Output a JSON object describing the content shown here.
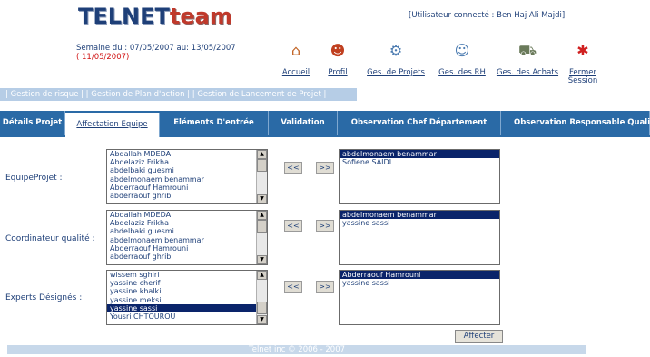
{
  "header": {
    "logo_part1": "TELNET",
    "logo_part2": "team",
    "user_status": "[Utilisateur connecté : Ben Haj Ali Majdi]",
    "week_line": "Semaine du : 07/05/2007 au: 13/05/2007",
    "week_date": "( 11/05/2007)"
  },
  "nav": [
    {
      "label": "Accueil",
      "icon": "house-icon",
      "glyph": "🏠"
    },
    {
      "label": "Profil",
      "icon": "user-profile-icon",
      "glyph": "👤"
    },
    {
      "label": "Ges. de Projets",
      "icon": "gears-icon",
      "glyph": "⚙"
    },
    {
      "label": "Ges. des RH",
      "icon": "person-icon",
      "glyph": "👤"
    },
    {
      "label": "Ges. des Achats",
      "icon": "cart-icon",
      "glyph": "🛒"
    },
    {
      "label": "Fermer Session",
      "icon": "logout-icon",
      "glyph": "🚶"
    }
  ],
  "linkbar": "| Gestion de risque |   | Gestion de Plan d'action |   | Gestion de Lancement de Projet |",
  "tabs": [
    {
      "label": "Détails Projet"
    },
    {
      "label": "Affectation Equipe"
    },
    {
      "label": "Eléments D'entrée"
    },
    {
      "label": "Validation"
    },
    {
      "label": "Observation Chef Département"
    },
    {
      "label": "Observation Responsable Quali"
    }
  ],
  "rows": [
    {
      "label": "EquipeProjet :",
      "available": [
        "Abdallah MDEDA",
        "Abdelaziz Frikha",
        "abdelbaki guesmi",
        "abdelmonaem benammar",
        "Abderraouf Hamrouni",
        "abderraouf ghribi"
      ],
      "selected": [
        "abdelmonaem benammar",
        "Sofiene SAIDI"
      ]
    },
    {
      "label": "Coordinateur qualité :",
      "available": [
        "Abdallah MDEDA",
        "Abdelaziz Frikha",
        "abdelbaki guesmi",
        "abdelmonaem benammar",
        "Abderraouf Hamrouni",
        "abderraouf ghribi"
      ],
      "selected": [
        "abdelmonaem benammar",
        "yassine sassi"
      ]
    },
    {
      "label": "Experts Désignés :",
      "available": [
        "wissem sghiri",
        "yassine cherif",
        "yassine khalki",
        "yassine meksi",
        "yassine sassi",
        "Yousri CHTOUROU"
      ],
      "selected": [
        "Abderraouf Hamrouni",
        "yassine sassi"
      ]
    }
  ],
  "buttons": {
    "remove": "<<",
    "add": ">>",
    "affecter": "Affecter"
  },
  "footer": "Telnet inc © 2006 - 2007"
}
